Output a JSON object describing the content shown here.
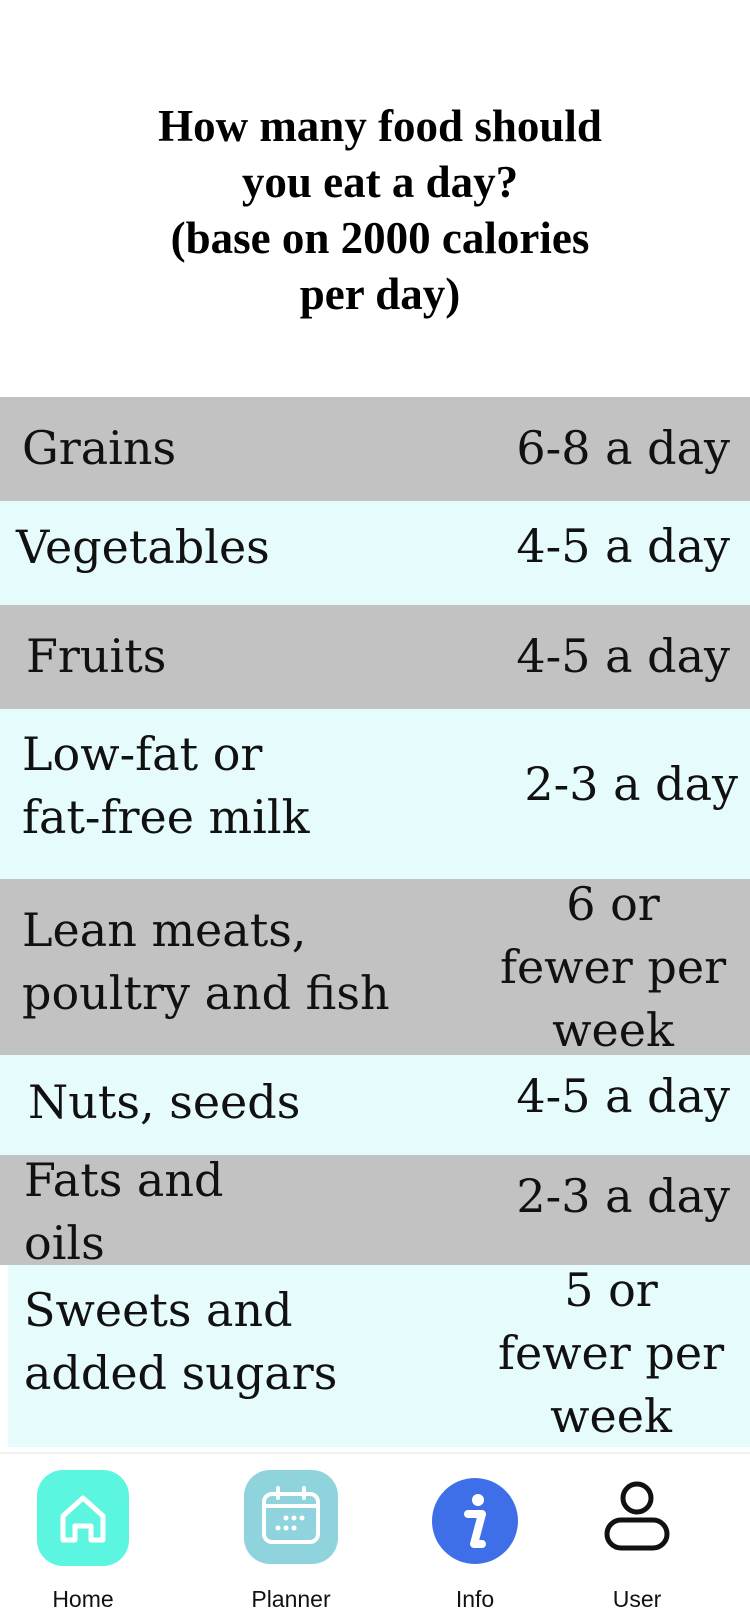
{
  "title": {
    "line1": "How many food should",
    "line2": "you eat a day?",
    "line3": "(base on 2000 calories",
    "line4": "per day)"
  },
  "rows": [
    {
      "food": [
        "Grains"
      ],
      "amount": [
        "6-8 a day"
      ]
    },
    {
      "food": [
        "Vegetables"
      ],
      "amount": [
        "4-5 a day"
      ]
    },
    {
      "food": [
        "Fruits"
      ],
      "amount": [
        "4-5 a day"
      ]
    },
    {
      "food": [
        "Low-fat or",
        "fat-free milk"
      ],
      "amount": [
        "2-3 a day"
      ]
    },
    {
      "food": [
        "Lean meats,",
        "poultry and fish"
      ],
      "amount": [
        "6 or",
        "fewer per",
        "week"
      ]
    },
    {
      "food": [
        "Nuts, seeds"
      ],
      "amount": [
        "4-5 a day"
      ]
    },
    {
      "food": [
        "Fats and",
        "oils"
      ],
      "amount": [
        "2-3 a day"
      ]
    },
    {
      "food": [
        "Sweets and",
        "added sugars"
      ],
      "amount": [
        "5 or",
        "fewer per",
        "week"
      ]
    }
  ],
  "tabs": {
    "home": {
      "label": "Home",
      "icon": "home-icon",
      "color": "#5cf5e0"
    },
    "planner": {
      "label": "Planner",
      "icon": "calendar-icon",
      "color": "#8fd3dc"
    },
    "info": {
      "label": "Info",
      "icon": "info-icon",
      "color": "#3f6fe8"
    },
    "user": {
      "label": "User",
      "icon": "user-icon"
    }
  },
  "colors": {
    "row_gray": "#c2c2c2",
    "row_cyan": "#e6fbfc"
  }
}
